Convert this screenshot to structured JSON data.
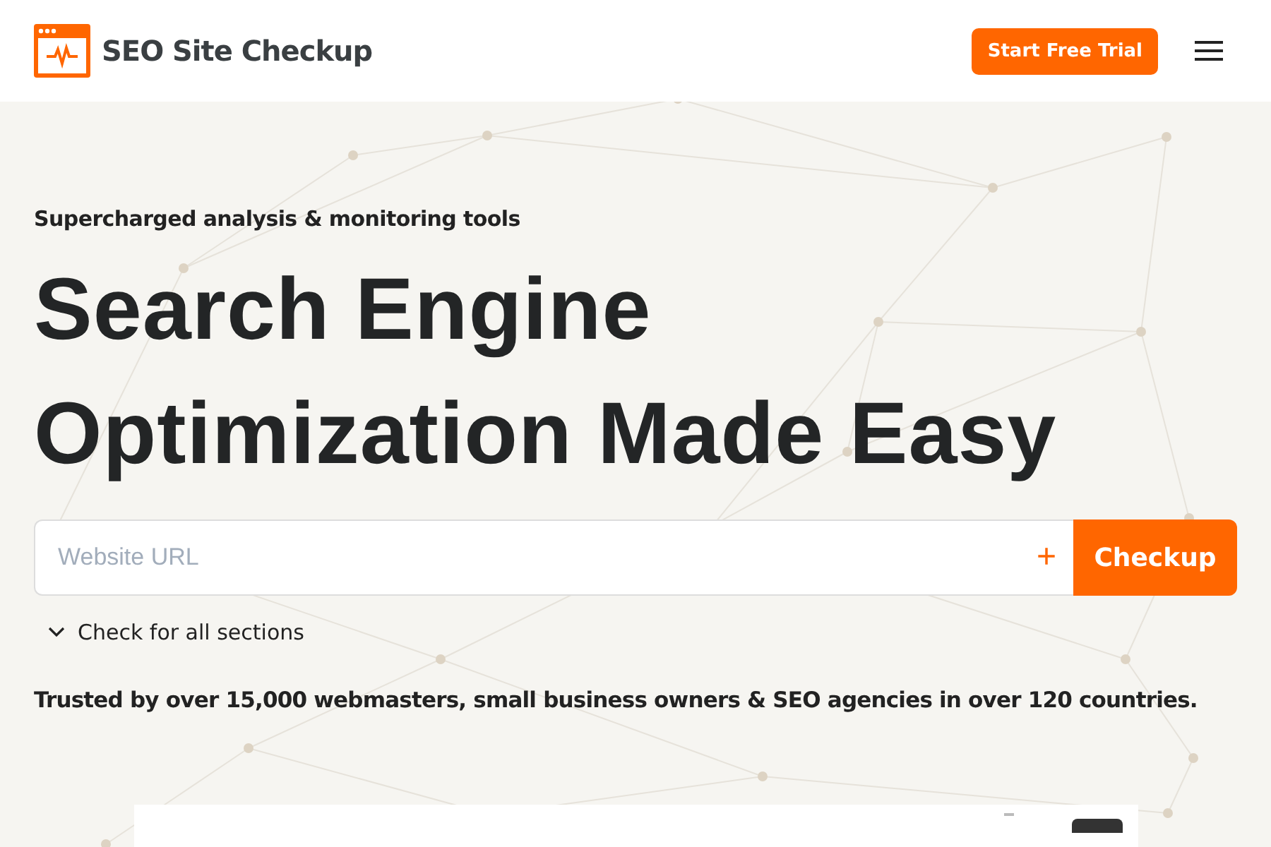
{
  "header": {
    "brand": "SEO Site Checkup",
    "cta_button": "Start Free Trial"
  },
  "hero": {
    "eyebrow": "Supercharged analysis & monitoring tools",
    "title_lines": [
      "Search Engine",
      "Optimization Made Easy"
    ],
    "url_field": {
      "placeholder": "Website URL"
    },
    "add_button": "+",
    "submit_button": "Checkup",
    "sections_toggle": {
      "label": "Check for all sections",
      "expanded": false
    },
    "trust_text": "Trusted by over 15,000 webmasters, small business owners & SEO agencies in over 120 countries."
  }
}
